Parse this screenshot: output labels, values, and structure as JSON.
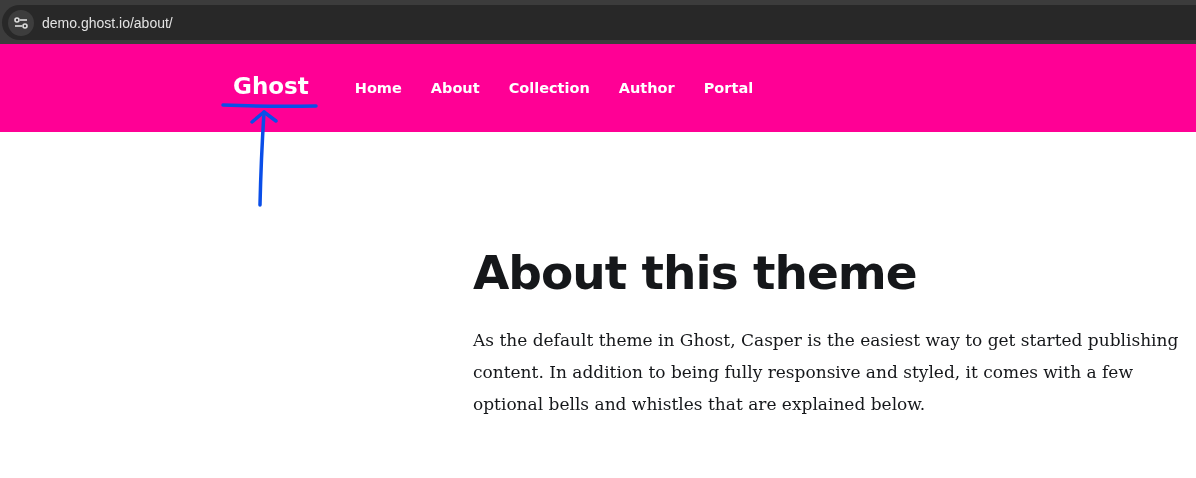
{
  "address_bar": {
    "url": "demo.ghost.io/about/"
  },
  "header": {
    "logo": "Ghost",
    "nav": [
      "Home",
      "About",
      "Collection",
      "Author",
      "Portal"
    ]
  },
  "article": {
    "title": "About this theme",
    "body": "As the default theme in Ghost, Casper is the easiest way to get started publishing content. In addition to being fully responsive and styled, it comes with a few optional bells and whistles that are explained below."
  }
}
